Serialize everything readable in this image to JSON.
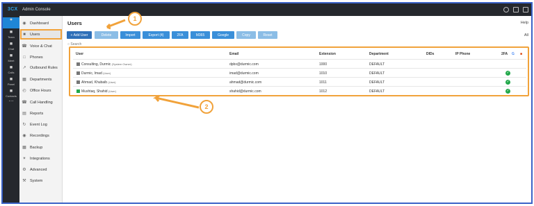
{
  "topbar": {
    "brand_prefix": "3CX",
    "app_name": "Admin Console"
  },
  "rail": [
    {
      "label": "",
      "icon": "bell-icon"
    },
    {
      "label": "Team",
      "icon": "team-icon"
    },
    {
      "label": "Chat",
      "icon": "chat-icon"
    },
    {
      "label": "Meet",
      "icon": "meet-icon"
    },
    {
      "label": "Calls",
      "icon": "calls-icon"
    },
    {
      "label": "Panel",
      "icon": "panel-icon"
    },
    {
      "label": "Contacts",
      "icon": "contacts-icon"
    },
    {
      "label": "",
      "icon": "more-icon"
    }
  ],
  "sidebar": {
    "items": [
      {
        "label": "Dashboard",
        "icon": "dashboard-icon"
      },
      {
        "label": "Users",
        "icon": "users-icon"
      },
      {
        "label": "Voice & Chat",
        "icon": "voice-chat-icon"
      },
      {
        "label": "Phones",
        "icon": "phones-icon"
      },
      {
        "label": "Outbound Rules",
        "icon": "outbound-rules-icon"
      },
      {
        "label": "Departments",
        "icon": "departments-icon"
      },
      {
        "label": "Office Hours",
        "icon": "office-hours-icon"
      },
      {
        "label": "Call Handling",
        "icon": "call-handling-icon"
      },
      {
        "label": "Reports",
        "icon": "reports-icon"
      },
      {
        "label": "Event Log",
        "icon": "event-log-icon"
      },
      {
        "label": "Recordings",
        "icon": "recordings-icon"
      },
      {
        "label": "Backup",
        "icon": "backup-icon"
      },
      {
        "label": "Integrations",
        "icon": "integrations-icon"
      },
      {
        "label": "Advanced",
        "icon": "advanced-icon"
      },
      {
        "label": "System",
        "icon": "system-icon"
      }
    ]
  },
  "main": {
    "title": "Users",
    "help": "Help",
    "all": "All",
    "search": "Search",
    "toolbar": [
      "+ Add User",
      "Delete",
      "Import",
      "Export (4)",
      "2FA",
      "M365",
      "Google",
      "Copy",
      "Reset"
    ],
    "columns": [
      "User",
      "Email",
      "Extension",
      "Department",
      "DIDs",
      "IP Phone",
      "2FA"
    ],
    "rows": [
      {
        "name": "Consulting, Durmic",
        "role": "(System Owner)",
        "email": "dpbx@durmic.com",
        "ext": "1000",
        "dept": "DEFAULT",
        "twofa": false,
        "status_color": "#777777"
      },
      {
        "name": "Durmic, Imad",
        "role": "(User)",
        "email": "imad@durmic.com",
        "ext": "1010",
        "dept": "DEFAULT",
        "twofa": true,
        "status_color": "#777777"
      },
      {
        "name": "Ahmad, Khubaib",
        "role": "(User)",
        "email": "ahmad@durmic.com",
        "ext": "1011",
        "dept": "DEFAULT",
        "twofa": true,
        "status_color": "#777777"
      },
      {
        "name": "Mushtaq, Shahid",
        "role": "(User)",
        "email": "shahid@durmic.com",
        "ext": "1012",
        "dept": "DEFAULT",
        "twofa": true,
        "status_color": "#22a84a"
      }
    ]
  },
  "annotations": {
    "badge1": "1",
    "badge2": "2"
  },
  "colors": {
    "accent": "#3a8fd9",
    "highlight": "#f1a23a",
    "border": "#3a62c7"
  }
}
